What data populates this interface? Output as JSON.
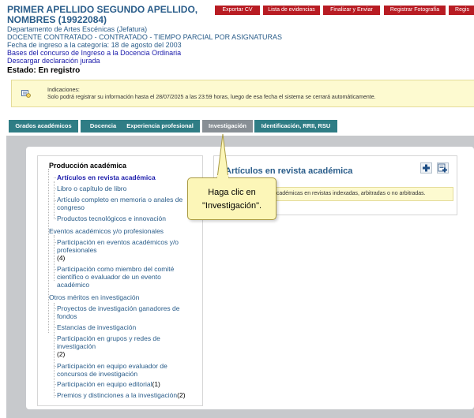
{
  "profile": {
    "name": "PRIMER APELLIDO SEGUNDO APELLIDO, NOMBRES (19922084)",
    "department": "Departamento de Artes Escénicas (Jefatura)",
    "position": "DOCENTE CONTRATADO - CONTRATADO - TIEMPO PARCIAL POR ASIGNATURAS",
    "entry_date": "Fecha de ingreso a la categoría: 18 de agosto del 2003",
    "link_bases": "Bases del concurso de Ingreso a la Docencia Ordinaria",
    "link_declaration": "Descargar declaración jurada",
    "status": "Estado: En registro"
  },
  "top_buttons": [
    "Exportar CV",
    "Lista de evidencias",
    "Finalizar y Enviar",
    "Registrar Fotografía",
    "Regis"
  ],
  "notice": {
    "title": "Indicaciones:",
    "text": "Solo podrá registrar su información hasta el 28/07/2025 a las 23:59 horas, luego de esa fecha el sistema se cerrará automáticamente.",
    "icon": "info-icon"
  },
  "tabs": [
    "Grados académicos",
    "Docencia",
    "Experiencia profesional",
    "Investigación",
    "Identificación, RRII, RSU"
  ],
  "tree": {
    "root": "Producción académica",
    "root_items": {
      "item1": "Artículos en revista académica",
      "item2": "Libro o capítulo de libro",
      "item3": "Artículo completo en memoria o anales de congreso",
      "item4": "Productos tecnológicos e innovación"
    },
    "group1": "Eventos académicos y/o profesionales",
    "group1_items": {
      "item1": "Participación en eventos académicos y/o profesionales",
      "item1_count": "(4)",
      "item2": "Participación como miembro del comité científico o evaluador de un evento académico"
    },
    "group2": "Otros méritos en investigación",
    "group2_items": {
      "item1": "Proyectos de investigación ganadores de fondos",
      "item2": "Estancias de investigación",
      "item3": "Participación en grupos y redes de investigación",
      "item3_count": "(2)",
      "item4": "Participación en equipo evaluador de concursos de investigación",
      "item5": "Participación en equipo editorial",
      "item5_count": "(1)",
      "item6": "Premios y distinciones a la investigación",
      "item6_count": "(2)"
    }
  },
  "article_panel": {
    "title": "Artículos en revista académica",
    "description": "académicas en revistas indexadas, arbitradas o no arbitradas.",
    "add_icon": "plus-icon",
    "add_list_icon": "add-list-icon"
  },
  "tooltip": {
    "line1": "Haga clic en",
    "line2": "\"Investigación\"."
  },
  "colors": {
    "button_red": "#b81c23",
    "tab_teal": "#2f7d85",
    "tab_active": "#888f95",
    "title_blue": "#2a5d8a",
    "link_blue": "#1a1aaa",
    "notice_yellow": "#fdfad0",
    "tooltip_yellow": "#fcf6b8"
  }
}
